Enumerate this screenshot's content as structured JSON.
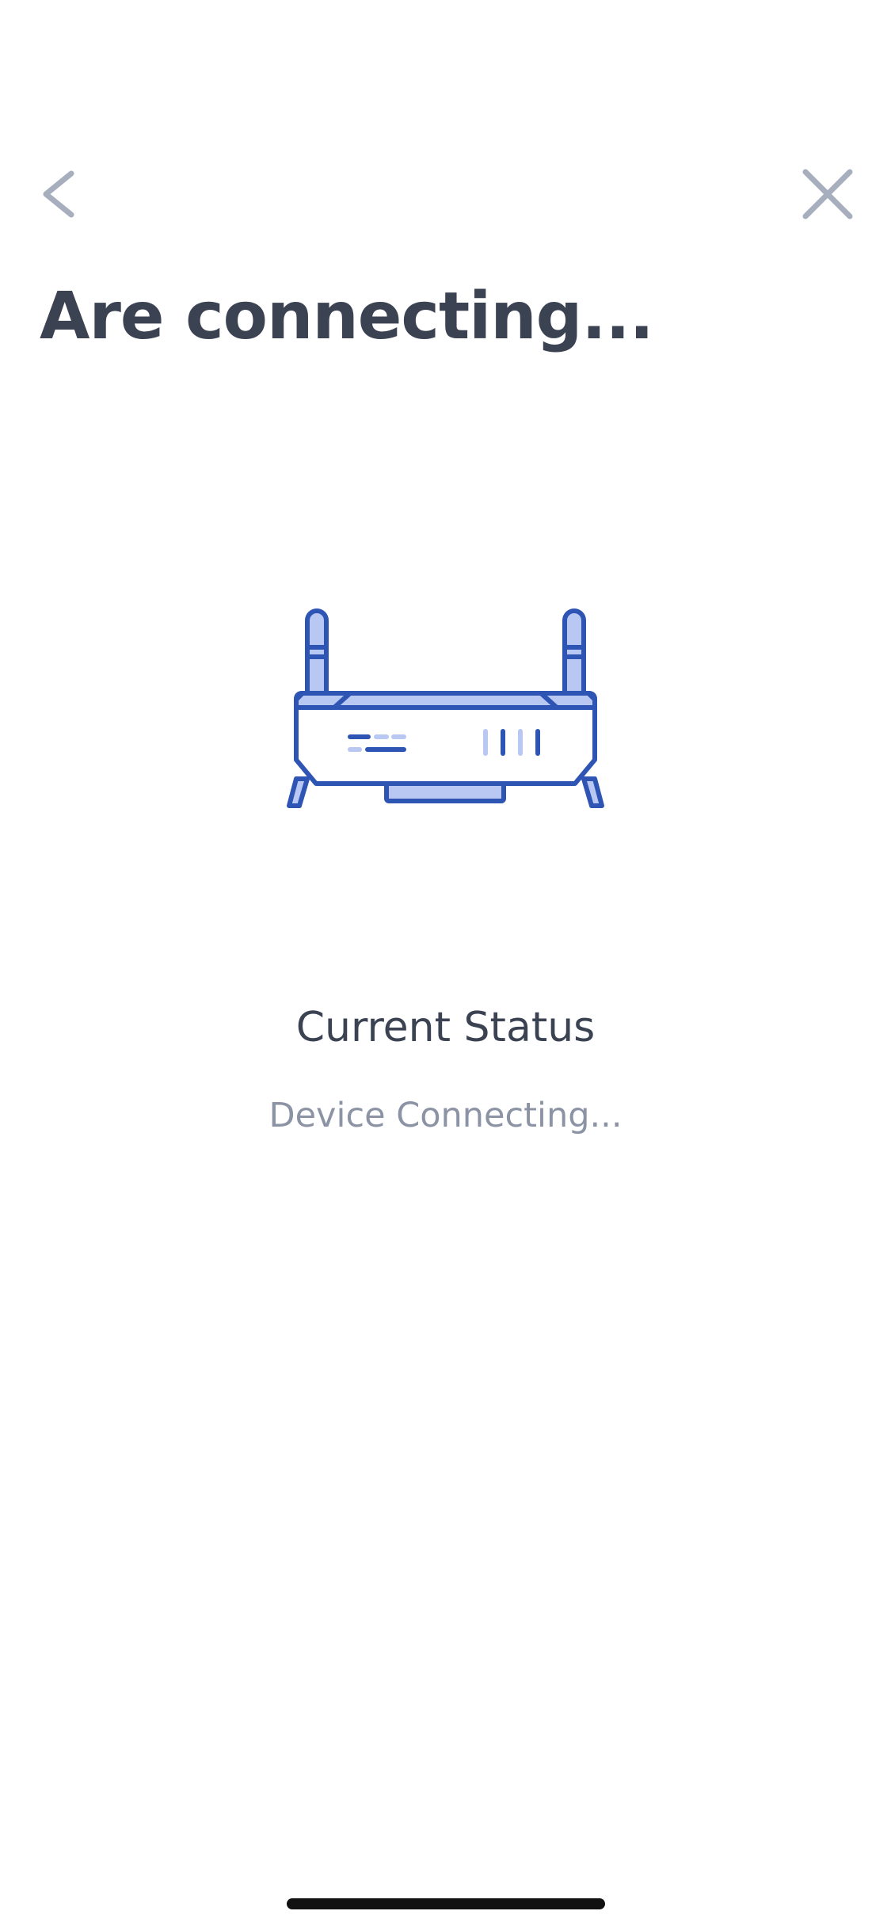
{
  "header": {
    "back_icon": "chevron-left-icon",
    "close_icon": "close-icon",
    "title": "Are connecting..."
  },
  "illustration": {
    "icon": "router-icon",
    "stroke_color": "#2f55b4",
    "fill_color": "#b9c8f2"
  },
  "status": {
    "label": "Current Status",
    "value": "Device Connecting..."
  },
  "colors": {
    "title_text": "#3b4252",
    "secondary_text": "#8b93a5",
    "nav_icons": "#a7afbe",
    "accent": "#2f55b4"
  }
}
